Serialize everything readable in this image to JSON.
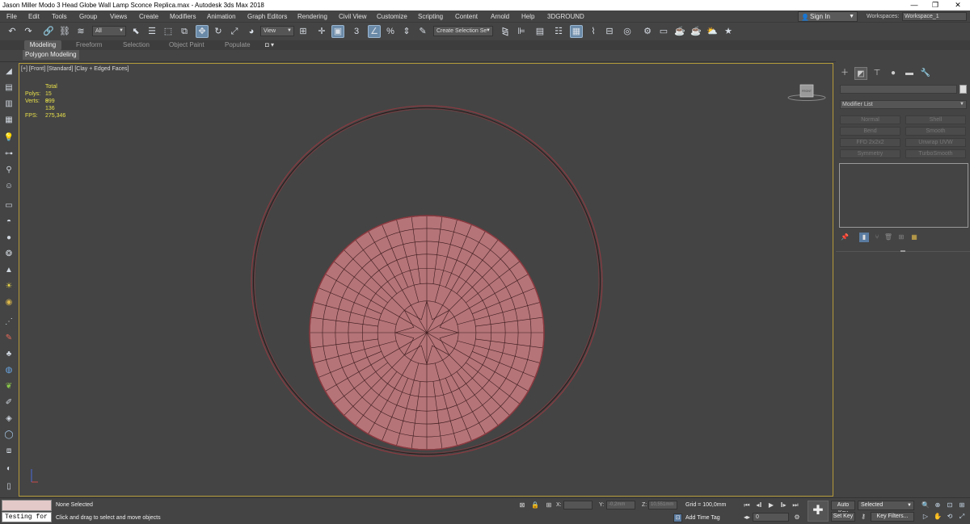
{
  "window": {
    "title": "Jason Miller Modo 3 Head Globe Wall Lamp Sconce Replica.max - Autodesk 3ds Max 2018",
    "minimize": "—",
    "restore": "❐",
    "close": "✕"
  },
  "menu": [
    "File",
    "Edit",
    "Tools",
    "Group",
    "Views",
    "Create",
    "Modifiers",
    "Animation",
    "Graph Editors",
    "Rendering",
    "Civil View",
    "Customize",
    "Scripting",
    "Content",
    "Arnold",
    "Help",
    "3DGROUND"
  ],
  "account": {
    "sign_in": "Sign In",
    "workspaces_label": "Workspaces:",
    "workspace": "Workspace_1"
  },
  "toolbar": {
    "selection_filter": "All",
    "reference_coord": "View",
    "named_selection": "Create Selection Se"
  },
  "ribbon": {
    "tabs": [
      "Modeling",
      "Freeform",
      "Selection",
      "Object Paint",
      "Populate"
    ],
    "active_tab": "Modeling",
    "panel": "Polygon Modeling"
  },
  "viewport": {
    "label": "[+] [Front] [Standard] [Clay + Edged Faces]",
    "stats": {
      "total_label": "Total",
      "polys_label": "Polys:",
      "polys": "15 899",
      "verts_label": "Verts:",
      "verts": "9 136",
      "fps_label": "FPS:",
      "fps": "275,346"
    },
    "viewcube_label": "FRONT",
    "colors": {
      "background": "#444444",
      "mesh_fill": "#b57478",
      "wire": "#3a1a1c",
      "ring": "#8a3a40",
      "border": "#b39a3a"
    }
  },
  "command_panel": {
    "modifier_list": "Modifier List",
    "modifier_buttons": [
      "Normal",
      "Shell",
      "Bend",
      "Smooth",
      "FFD 2x2x2",
      "Unwrap UVW",
      "Symmetry",
      "TurboSmooth"
    ]
  },
  "status": {
    "selection": "None Selected",
    "hint": "Click and drag to select and move objects",
    "listener": "Testing for",
    "x_label": "X:",
    "y_label": "Y:",
    "y_value": "-0,2mm",
    "z_label": "Z:",
    "z_value": "10,551mm",
    "grid": "Grid = 100,0mm",
    "add_time_tag": "Add Time Tag",
    "frame": "0",
    "auto_key": "Auto Key",
    "set_key": "Set Key",
    "key_mode": "Selected",
    "key_filters": "Key Filters..."
  }
}
